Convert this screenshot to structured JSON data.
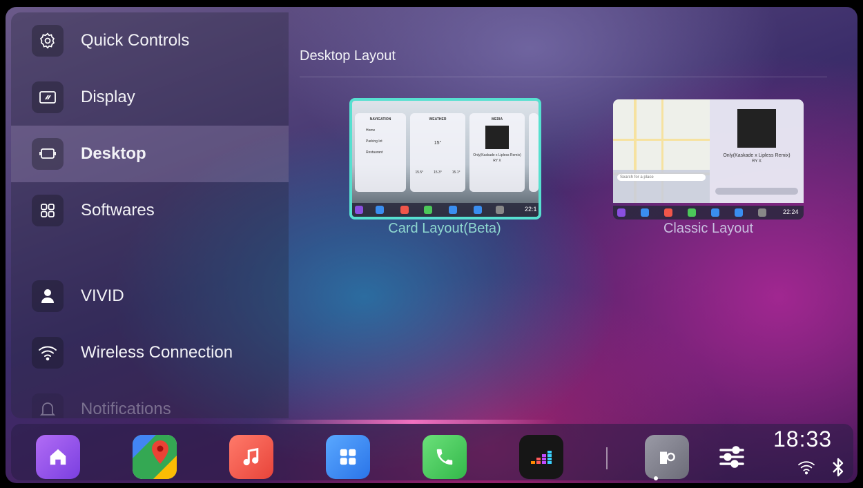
{
  "sidebar": {
    "items": [
      {
        "label": "Quick Controls",
        "icon": "gear-icon"
      },
      {
        "label": "Display",
        "icon": "display-icon"
      },
      {
        "label": "Desktop",
        "icon": "desktop-icon",
        "selected": true
      },
      {
        "label": "Softwares",
        "icon": "grid-icon"
      },
      {
        "label": "VIVID",
        "icon": "person-icon"
      },
      {
        "label": "Wireless Connection",
        "icon": "wifi-icon"
      },
      {
        "label": "Notifications",
        "icon": "bell-icon"
      }
    ]
  },
  "content": {
    "title": "Desktop Layout",
    "layouts": [
      {
        "label": "Card Layout(Beta)",
        "selected": true
      },
      {
        "label": "Classic Layout",
        "selected": false
      }
    ],
    "card_preview": {
      "nav_title": "NAVIGATION",
      "weather_title": "WEATHER",
      "media_title": "MEDIA",
      "nav_items": [
        "Home",
        "Parking lot",
        "Restaurant"
      ],
      "temp": "15°",
      "temps": [
        "15.5°",
        "15.3°",
        "15.1°"
      ],
      "song": "Only(Kaskade x Lipless Remix)",
      "artist": "RY X",
      "time": "22:1"
    },
    "classic_preview": {
      "song": "Only(Kaskade x Lipless Remix)",
      "artist": "RY X",
      "search_placeholder": "Search for a place",
      "time": "22:24"
    }
  },
  "dock": {
    "apps": [
      "home-icon",
      "google-maps-icon",
      "music-icon",
      "apps-grid-icon",
      "phone-icon",
      "deezer-icon",
      "car-settings-icon",
      "equalizer-icon"
    ],
    "time": "18:33"
  },
  "colors": {
    "accent": "#57e0d0",
    "home": "#8a4fe0",
    "music": "#f0564a",
    "apps": "#3a8ef0",
    "phone": "#4cc85a"
  }
}
